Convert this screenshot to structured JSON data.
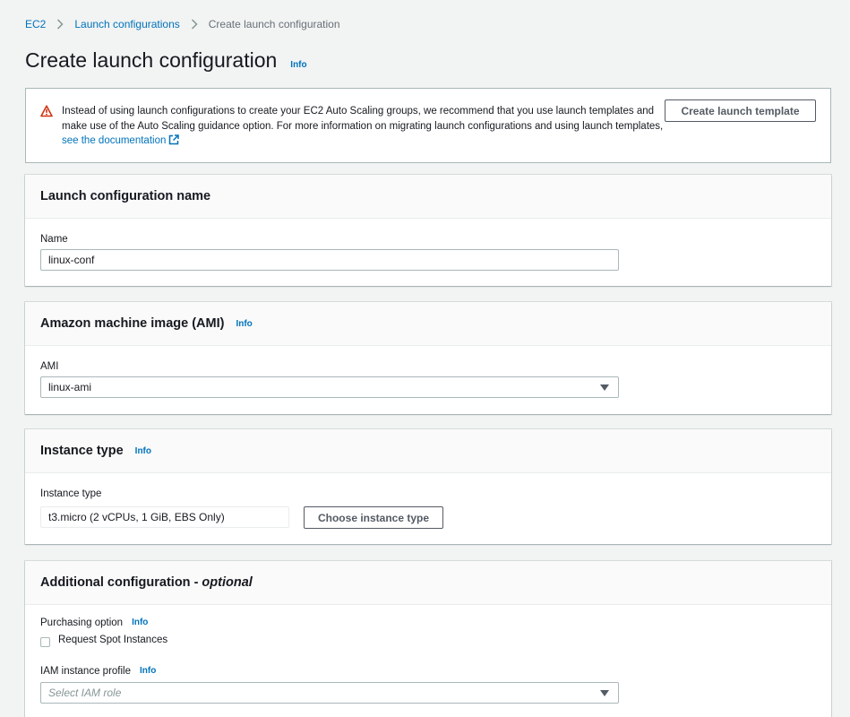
{
  "breadcrumb": {
    "items": [
      "EC2",
      "Launch configurations"
    ],
    "current": "Create launch configuration"
  },
  "page": {
    "title": "Create launch configuration",
    "info": "Info"
  },
  "alert": {
    "text": "Instead of using launch configurations to create your EC2 Auto Scaling groups, we recommend that you use launch templates and make use of the Auto Scaling guidance option. For more information on migrating launch configurations and using launch templates, ",
    "link": "see the documentation",
    "button": "Create launch template",
    "icon_color": "#d13212"
  },
  "name_panel": {
    "title": "Launch configuration name",
    "label": "Name",
    "value": "linux-conf"
  },
  "ami_panel": {
    "title": "Amazon machine image (AMI)",
    "info": "Info",
    "label": "AMI",
    "value": "linux-ami"
  },
  "instance_panel": {
    "title": "Instance type",
    "info": "Info",
    "label": "Instance type",
    "value": "t3.micro (2 vCPUs, 1 GiB, EBS Only)",
    "button": "Choose instance type"
  },
  "additional_panel": {
    "title": "Additional configuration - ",
    "title_em": "optional",
    "purchasing_label": "Purchasing option",
    "purchasing_info": "Info",
    "spot_label": "Request Spot Instances",
    "spot_checked": false,
    "iam_label": "IAM instance profile",
    "iam_info": "Info",
    "iam_placeholder": "Select IAM role"
  },
  "colors": {
    "link": "#0073bb",
    "background": "#f2f3f3",
    "text": "#16191f"
  }
}
